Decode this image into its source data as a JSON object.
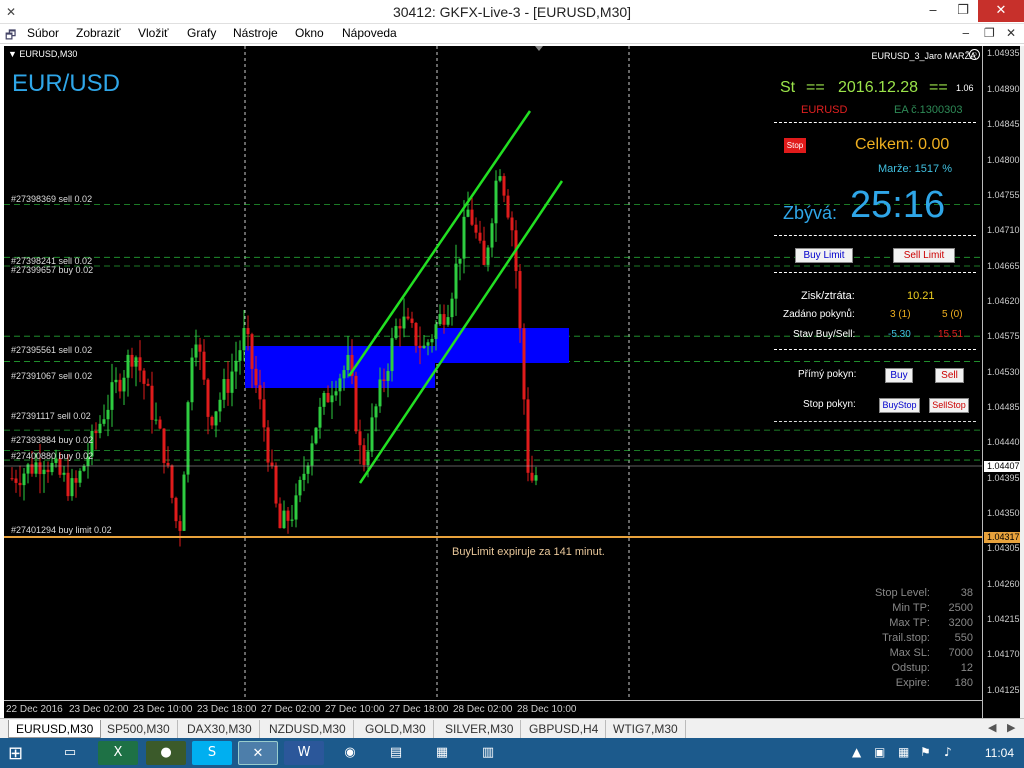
{
  "window": {
    "title": "30412: GKFX-Live-3 - [EURUSD,M30]",
    "minimize": "‒",
    "restore": "❐",
    "close": "✕"
  },
  "menu": {
    "items": [
      "Súbor",
      "Zobraziť",
      "Vložiť",
      "Grafy",
      "Nástroje",
      "Okno",
      "Nápoveda"
    ],
    "doc_min": "‒",
    "doc_restore": "❐",
    "doc_close": "✕"
  },
  "chart": {
    "header_symbol": "▼ EURUSD,M30",
    "ea_title": "EURUSD_3_Jaro MARŽA",
    "big_symbol": "EUR/USD",
    "expiry_note": "BuyLimit expiruje za 141 minut.",
    "order_labels": [
      {
        "text": "#27398369 sell 0.02",
        "price": 1.04743
      },
      {
        "text": "#27398241 sell 0.02",
        "price": 1.04676
      },
      {
        "text": "#27399657 buy 0.02",
        "price": 1.04665
      },
      {
        "text": "#27395561 sell 0.02",
        "price": 1.04576
      },
      {
        "text": "#27391067 sell 0.02",
        "price": 1.04544
      },
      {
        "text": "#27391117 sell 0.02",
        "price": 1.04457
      },
      {
        "text": "#27393884 buy 0.02",
        "price": 1.04431
      },
      {
        "text": "#27400880 buy 0.02",
        "price": 1.04419
      },
      {
        "text": "#27401294 buy limit 0.02",
        "price": 1.04328
      }
    ]
  },
  "panel": {
    "day": "St",
    "eq1": "==",
    "date": "2016.12.28",
    "eq2": "==",
    "version": "1.06",
    "symbol": "EURUSD",
    "ea_no": "EA č.1300303",
    "stop_btn": "Stop",
    "celkem": "Celkem: 0.00",
    "marze": "Marže:  1517 %",
    "zbyva_label": "Zbývá:",
    "timer": "25:16",
    "buy_limit": "Buy Limit",
    "sell_limit": "Sell Limit",
    "pl_label": "Zisk/ztráta:",
    "pl_value": "10.21",
    "orders_label": "Zadáno pokynů:",
    "orders_buy": "3 (1)",
    "orders_sell": "5 (0)",
    "state_label": "Stav Buy/Sell:",
    "state_buy": "-5.30",
    "state_sell": "15.51",
    "direct_label": "Přímý pokyn:",
    "buy": "Buy",
    "sell": "Sell",
    "stop_label": "Stop pokyn:",
    "buystop": "BuyStop",
    "sellstop": "SellStop"
  },
  "params": [
    {
      "label": "Stop Level:",
      "value": "38"
    },
    {
      "label": "Min TP:",
      "value": "2500"
    },
    {
      "label": "Max TP:",
      "value": "3200"
    },
    {
      "label": "Trail.stop:",
      "value": "550"
    },
    {
      "label": "Max SL:",
      "value": "7000"
    },
    {
      "label": "Odstup:",
      "value": "12"
    },
    {
      "label": "Expire:",
      "value": "180"
    }
  ],
  "price_axis": {
    "labels": [
      "1.04935",
      "1.04890",
      "1.04845",
      "1.04800",
      "1.04755",
      "1.04710",
      "1.04665",
      "1.04620",
      "1.04575",
      "1.04530",
      "1.04485",
      "1.04440",
      "1.04395",
      "1.04350",
      "1.04305",
      "1.04260",
      "1.04215",
      "1.04170",
      "1.04125"
    ],
    "current": "1.04407",
    "limit": "1.04317"
  },
  "time_axis": {
    "labels": [
      "22 Dec 2016",
      "23 Dec 02:00",
      "23 Dec 10:00",
      "23 Dec 18:00",
      "27 Dec 02:00",
      "27 Dec 10:00",
      "27 Dec 18:00",
      "28 Dec 02:00",
      "28 Dec 10:00"
    ]
  },
  "tabs": [
    "EURUSD,M30",
    "SP500,M30",
    "DAX30,M30",
    "NZDUSD,M30",
    "GOLD,M30",
    "SILVER,M30",
    "GBPUSD,H4",
    "WTIG7,M30"
  ],
  "taskbar": {
    "clock": "11:04"
  },
  "colors": {
    "bull": "#2ecc40",
    "bear": "#e01b1b",
    "channel": "#22e022",
    "zone": "#0000ff",
    "accent": "#2fa6e8",
    "limit": "#e8a23c"
  }
}
